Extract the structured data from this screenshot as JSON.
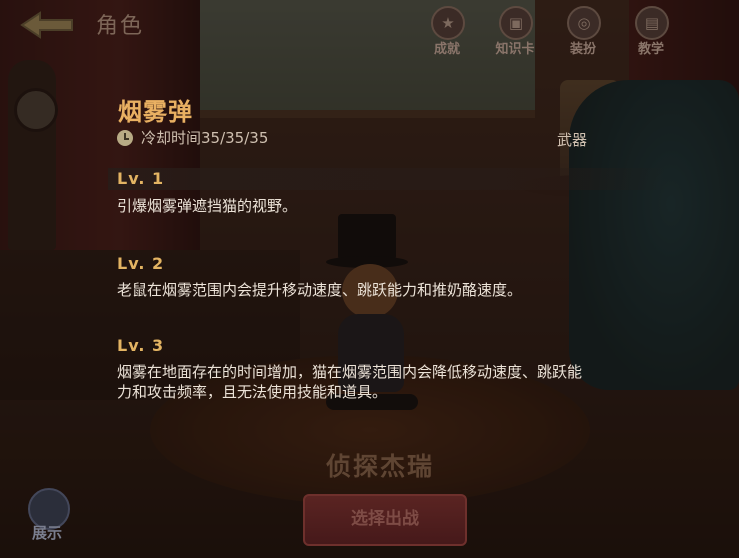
{
  "header": {
    "title": "角色",
    "nav": [
      {
        "label": "成就",
        "icon": "achievement-icon"
      },
      {
        "label": "知识卡",
        "icon": "knowledge-card-icon"
      },
      {
        "label": "装扮",
        "icon": "outfit-icon"
      },
      {
        "label": "教学",
        "icon": "tutorial-icon"
      }
    ]
  },
  "skill": {
    "name": "烟雾弹",
    "cooldown": "冷却时间35/35/35",
    "type": "武器",
    "levels": [
      {
        "label": "Lv. 1",
        "desc": "引爆烟雾弹遮挡猫的视野。"
      },
      {
        "label": "Lv. 2",
        "desc": "老鼠在烟雾范围内会提升移动速度、跳跃能力和推奶酪速度。"
      },
      {
        "label": "Lv. 3",
        "desc": "烟雾在地面存在的时间增加，猫在烟雾范围内会降低移动速度、跳跃能力和攻击频率，且无法使用技能和道具。"
      }
    ]
  },
  "character": {
    "name": "侦探杰瑞"
  },
  "footer": {
    "select_label": "选择出战",
    "show_label": "展示"
  },
  "colors": {
    "accent": "#e9b062",
    "text": "#ece3d8"
  }
}
